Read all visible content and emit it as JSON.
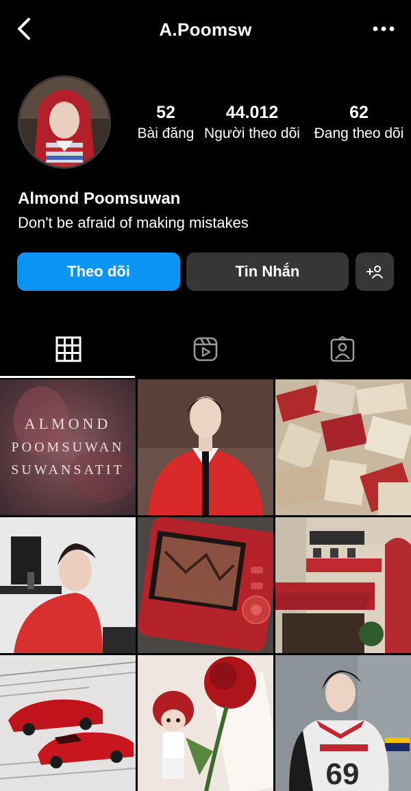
{
  "header": {
    "username": "A.Poomsw",
    "back_icon": "chevron-left-icon",
    "more_icon": "more-horizontal-icon"
  },
  "profile": {
    "stats": [
      {
        "value": "52",
        "label": "Bài đăng"
      },
      {
        "value": "44.012",
        "label": "Người theo dõi"
      },
      {
        "value": "62",
        "label": "Đang theo dõi"
      }
    ],
    "display_name": "Almond Poomsuwan",
    "bio": "Don't be afraid of making mistakes"
  },
  "actions": {
    "follow_label": "Theo dõi",
    "message_label": "Tin Nhắn",
    "add_icon": "add-person-icon",
    "follow_color": "#0A95F5"
  },
  "tabs": [
    {
      "name": "posts",
      "icon": "grid-icon",
      "active": true
    },
    {
      "name": "reels",
      "icon": "reels-icon",
      "active": false
    },
    {
      "name": "tagged",
      "icon": "tagged-person-icon",
      "active": false
    }
  ],
  "grid": {
    "post1_text": [
      "ALMOND",
      "POOMSUWAN",
      "SUWANSATIT"
    ],
    "post_count_visible": 9
  }
}
